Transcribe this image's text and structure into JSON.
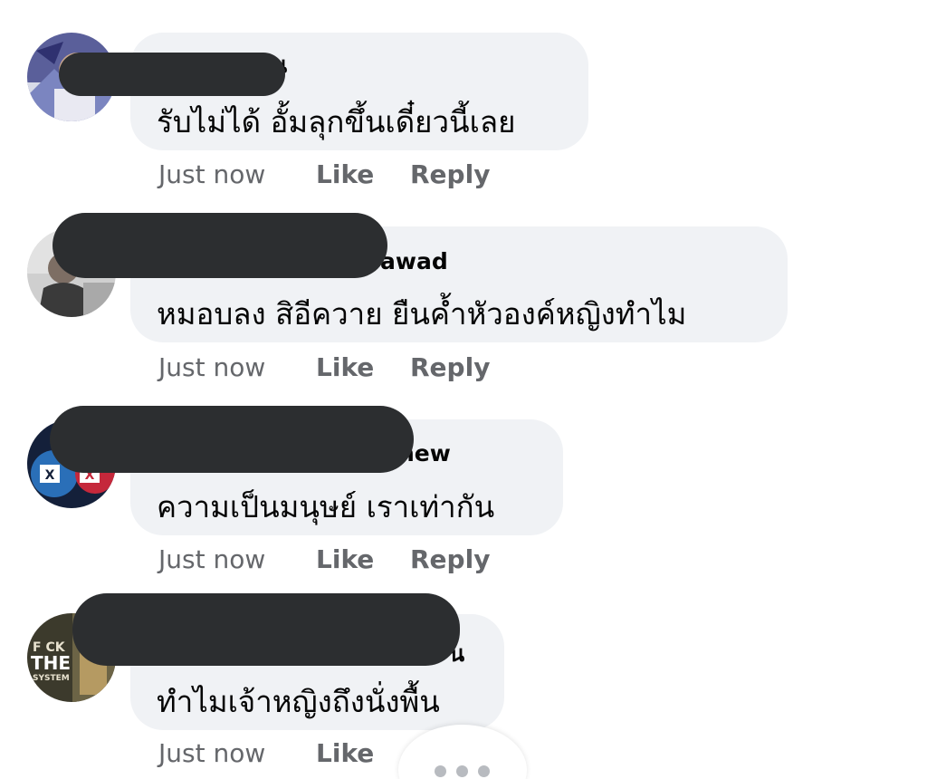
{
  "comments": [
    {
      "name_visible": " น",
      "text": "รับไม่ได้ อั้มลุกขึ้นเดี๋ยวนี้เลย",
      "time": "Just now",
      "actions": [
        "Like",
        "Reply"
      ]
    },
    {
      "name_visible": "awad",
      "text": "หมอบลง สิอีควาย ยืนค้ำหัวองค์หญิงทำไม",
      "time": "Just now",
      "actions": [
        "Like",
        "Reply"
      ]
    },
    {
      "name_visible": "new",
      "text": "ความเป็นมนุษย์ เราเท่ากัน",
      "time": "Just now",
      "actions": [
        "Like",
        "Reply"
      ]
    },
    {
      "name_visible": "น",
      "text": "ทำไมเจ้าหญิงถึงนั่งพื้น",
      "time": "Just now",
      "actions": [
        "Like"
      ]
    }
  ],
  "avatar4_text": [
    "F CK",
    "THE",
    "SYSTEM"
  ],
  "colors": {
    "bubble": "#f0f2f5",
    "redaction": "#2c2e30",
    "meta_text": "#65676b"
  },
  "icons": {
    "more": "more-dots-icon"
  }
}
